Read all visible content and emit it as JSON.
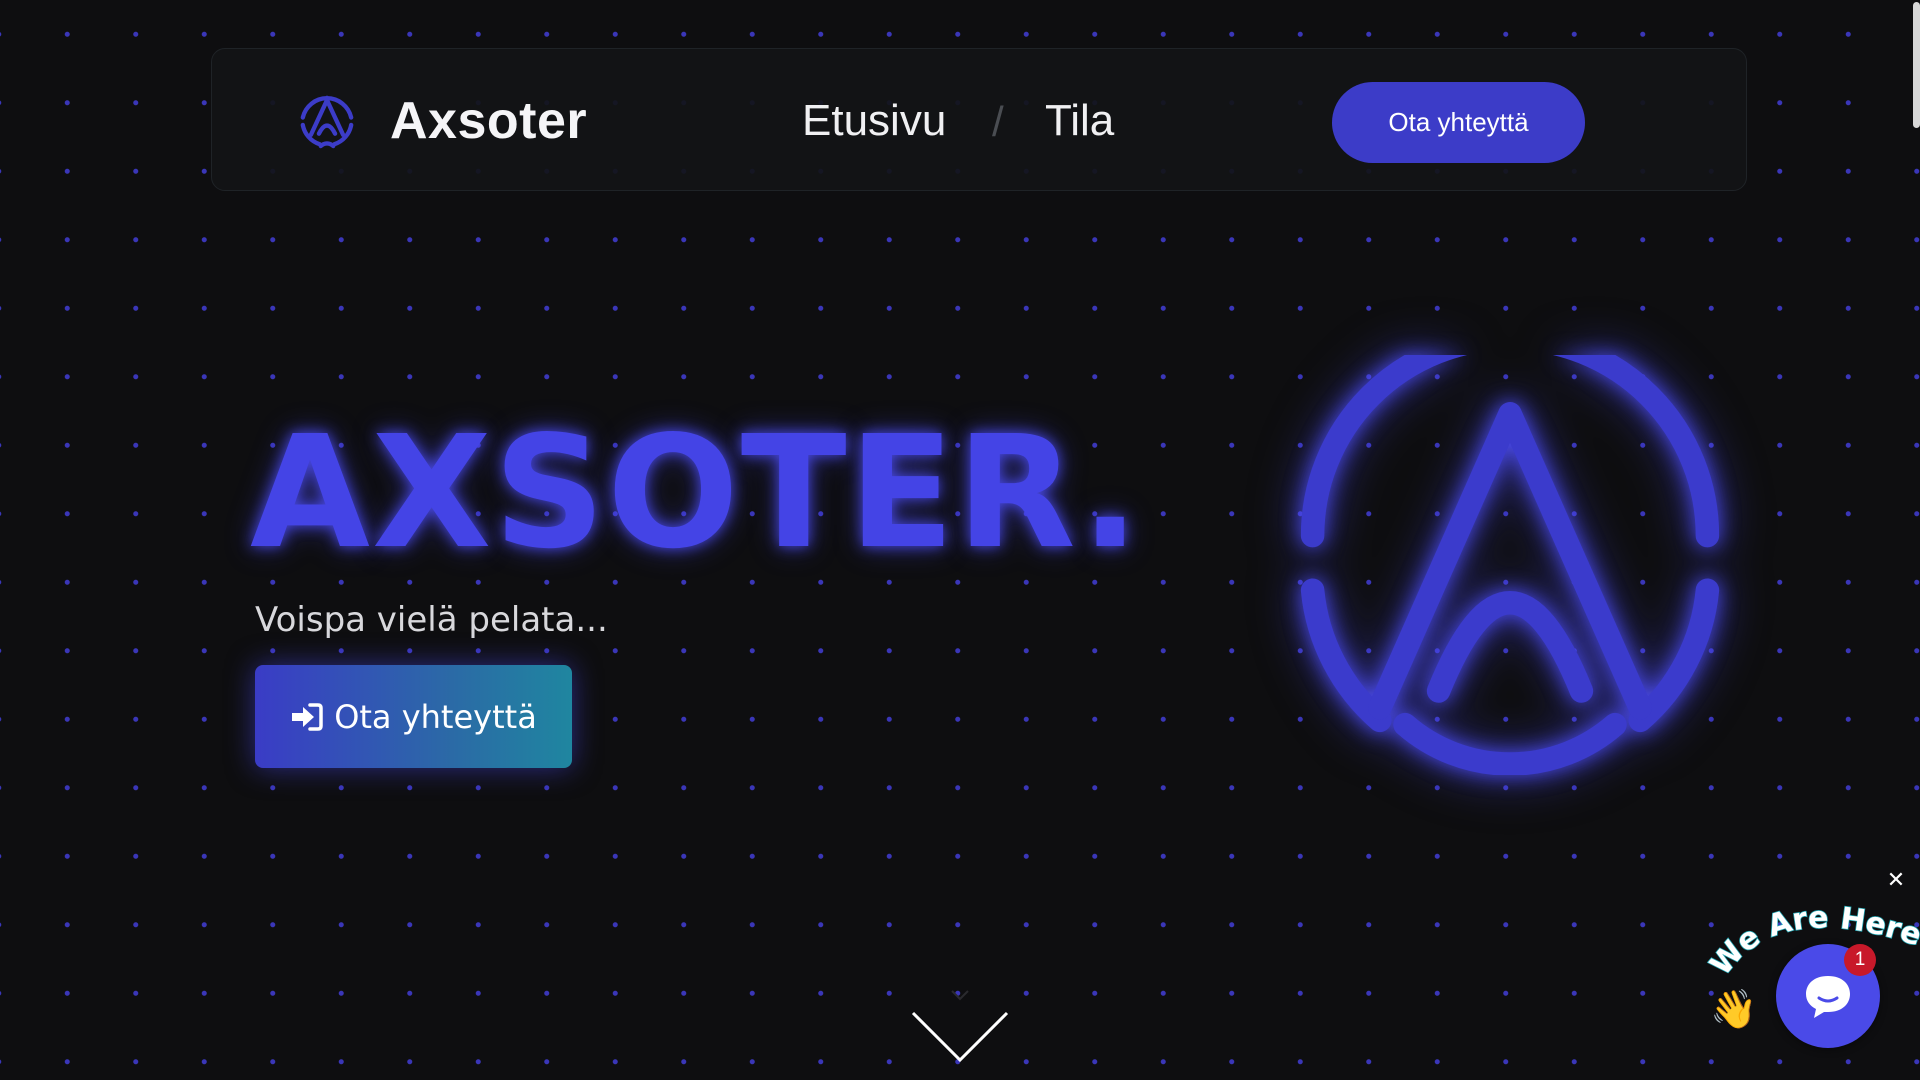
{
  "header": {
    "brand_name": "Axsoter",
    "nav": [
      {
        "label": "Etusivu"
      },
      {
        "separator": "/"
      },
      {
        "label": "Tila"
      }
    ],
    "contact_button_label": "Ota yhteyttä"
  },
  "hero": {
    "title": "AXSOTER.",
    "subtitle": "Voispa vielä pelata...",
    "cta_label": "Ota yhteyttä",
    "cta_icon": "sign-in-icon"
  },
  "scroll_indicator_icon": "chevron-down-icon",
  "chat_widget": {
    "tagline": "We Are Here!",
    "wave_emoji": "👋",
    "unread_count": "1",
    "close_symbol": "✕",
    "icon": "chat-bubble-icon"
  },
  "colors": {
    "background": "#0e0e10",
    "accent": "#3c3cc8",
    "title_glow": "#4444e6",
    "badge": "#c8192a"
  }
}
